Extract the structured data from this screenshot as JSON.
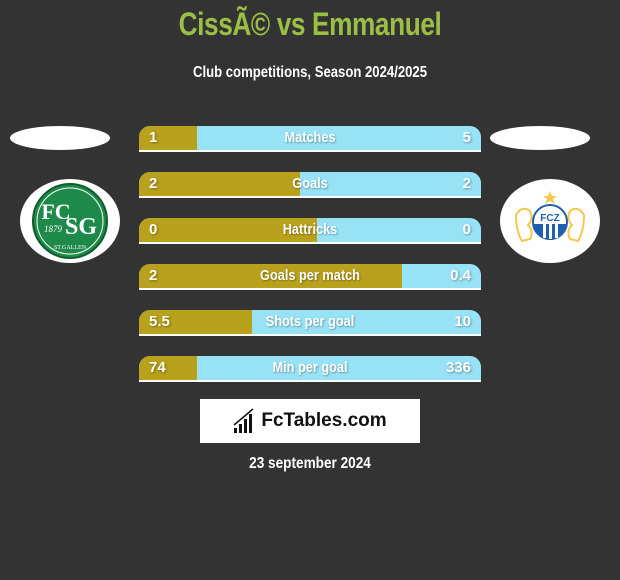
{
  "header": {
    "title": "CissÃ© vs Emmanuel",
    "subtitle": "Club competitions, Season 2024/2025"
  },
  "teams": {
    "left": {
      "name": "FC St. Gallen",
      "logo_icon": "fc-st-gallen-crest-icon",
      "crest_text": "FCSG",
      "crest_year": "1879",
      "crest_sub": "ST.GALLEN"
    },
    "right": {
      "name": "FC Zürich",
      "logo_icon": "fc-zurich-crest-icon",
      "crest_text": "FCZ"
    }
  },
  "colors": {
    "left": "#B8A11C",
    "right": "#98E2F6",
    "title": "#9BBF45",
    "background": "#333333"
  },
  "stats": [
    {
      "label": "Matches",
      "left": "1",
      "right": "5",
      "left_share": 0.17
    },
    {
      "label": "Goals",
      "left": "2",
      "right": "2",
      "left_share": 0.47
    },
    {
      "label": "Hattricks",
      "left": "0",
      "right": "0",
      "left_share": 0.52
    },
    {
      "label": "Goals per match",
      "left": "2",
      "right": "0.4",
      "left_share": 0.77
    },
    {
      "label": "Shots per goal",
      "left": "5.5",
      "right": "10",
      "left_share": 0.33
    },
    {
      "label": "Min per goal",
      "left": "74",
      "right": "336",
      "left_share": 0.17
    }
  ],
  "brand": {
    "name": "FcTables.com",
    "icon": "bar-chart-icon"
  },
  "footer": {
    "date": "23 september 2024"
  }
}
